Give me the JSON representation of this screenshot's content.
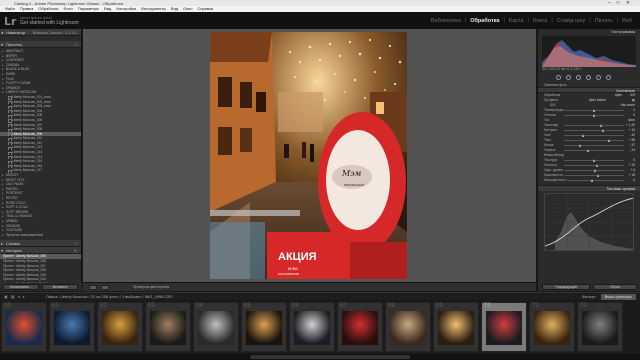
{
  "app": {
    "title": "Catalog-2 - Adobe Photoshop Lightroom Classic - Обработка",
    "menu": [
      "Файл",
      "Правка",
      "Обработка",
      "Фото",
      "Параметры",
      "Вид",
      "Настройки",
      "Инструменты",
      "Вид",
      "Окно",
      "Справка"
    ],
    "catalog_owner": "lorem ipsum dolor",
    "catalog_subtitle": "Get started with Lightroom",
    "modules": [
      "Библиотека",
      "Обработка",
      "Карта",
      "Книга",
      "Слайд-шоу",
      "Печать",
      "Веб"
    ],
    "active_module": "Обработка"
  },
  "left_panel": {
    "navigator_header": "Навигатор",
    "navigator_tools": "Вписать  Заполн.  1:1  3:1",
    "presets_header": "Пресеты",
    "presets": [
      {
        "label": "ABSTRACT",
        "type": "folder"
      },
      {
        "label": "BERRY",
        "type": "folder"
      },
      {
        "label": "CONTRAST",
        "type": "folder"
      },
      {
        "label": "CINEMA",
        "type": "folder"
      },
      {
        "label": "BLACK & BLUE",
        "type": "folder"
      },
      {
        "label": "DARK",
        "type": "folder"
      },
      {
        "label": "FILM",
        "type": "folder"
      },
      {
        "label": "FLUFFY CLEAN",
        "type": "folder"
      },
      {
        "label": "ORANGE",
        "type": "folder"
      },
      {
        "label": "LIBERTY MOSCOW",
        "type": "folder-open"
      },
      {
        "label": "Liberty Moscow_001_ecoc",
        "type": "child"
      },
      {
        "label": "Liberty Moscow_002_ecoc",
        "type": "child"
      },
      {
        "label": "Liberty Moscow_003_ecoc",
        "type": "child"
      },
      {
        "label": "Liberty Moscow_004",
        "type": "child"
      },
      {
        "label": "Liberty Moscow_005",
        "type": "child"
      },
      {
        "label": "Liberty Moscow_006",
        "type": "child"
      },
      {
        "label": "Liberty Moscow_007",
        "type": "child"
      },
      {
        "label": "Liberty Moscow_008",
        "type": "child"
      },
      {
        "label": "Liberty Moscow_009",
        "type": "child-selected"
      },
      {
        "label": "Liberty Moscow_010",
        "type": "child"
      },
      {
        "label": "Liberty Moscow_011",
        "type": "child"
      },
      {
        "label": "Liberty Moscow_012",
        "type": "child"
      },
      {
        "label": "Liberty Moscow_013",
        "type": "child"
      },
      {
        "label": "Liberty Moscow_014",
        "type": "child"
      },
      {
        "label": "Liberty Moscow_015",
        "type": "child"
      },
      {
        "label": "Liberty Moscow_016",
        "type": "child"
      },
      {
        "label": "Liberty Moscow_017",
        "type": "child"
      },
      {
        "label": "MOODY",
        "type": "folder"
      },
      {
        "label": "NIGHT CITY",
        "type": "folder"
      },
      {
        "label": "OLD FILMS",
        "type": "folder"
      },
      {
        "label": "PASTEL",
        "type": "folder"
      },
      {
        "label": "PORTRAIT",
        "type": "folder"
      },
      {
        "label": "RETRO",
        "type": "folder"
      },
      {
        "label": "ROSE GOLD",
        "type": "folder"
      },
      {
        "label": "SOFT & COLD",
        "type": "folder"
      },
      {
        "label": "SOFT BROWN",
        "type": "folder"
      },
      {
        "label": "TEAL & ORANGE",
        "type": "folder"
      },
      {
        "label": "URBAN",
        "type": "folder"
      },
      {
        "label": "VINTAGE",
        "type": "folder"
      },
      {
        "label": "YOUTUBE",
        "type": "folder"
      },
      {
        "label": "Пресеты пользователей",
        "type": "folder"
      }
    ],
    "snapshots_header": "Снимки",
    "history_header": "История",
    "history": [
      "Пресет: Liberty Moscow_009",
      "Пресет: Liberty Moscow_008",
      "Пресет: Liberty Moscow_007",
      "Пресет: Liberty Moscow_006",
      "Пресет: Liberty Moscow_005",
      "Пресет: Liberty Moscow_004",
      "Импорт (21.01.2021 18:05:27)"
    ],
    "copy_button": "Копировать...",
    "paste_button": "Вставить"
  },
  "toolbar": {
    "soft_proof": "Проверка цветопробы"
  },
  "right_panel": {
    "histogram_header": "Гистограмма",
    "histogram_info": "ISO 1600   35 мм   f/1,4   1/80 с",
    "original_photo": "Оригинал фото",
    "basic_header": "Основные",
    "treatment_label": "Обработка:",
    "treatment_color": "Цвет",
    "treatment_bw": "Ч/б",
    "profile_label": "Профиль:",
    "profile_value": "Цвет Adobe",
    "wb_label": "Б/Б:",
    "wb_value": "Как снято",
    "sliders": [
      {
        "label": "Температура",
        "value": "0",
        "pos": 0.5
      },
      {
        "label": "Оттенок",
        "value": "0",
        "pos": 0.5
      },
      {
        "label": "Тон",
        "value": "Авто",
        "pos": -1
      },
      {
        "label": "Экспонир.",
        "value": "+ 1,20",
        "pos": 0.62
      },
      {
        "label": "Контраст",
        "value": "+ 43",
        "pos": 0.66
      },
      {
        "label": "Свет",
        "value": "- 40",
        "pos": 0.32
      },
      {
        "label": "Тени",
        "value": "+ 58",
        "pos": 0.75
      },
      {
        "label": "Белые",
        "value": "- 57",
        "pos": 0.28
      },
      {
        "label": "Черные",
        "value": "- 24",
        "pos": 0.4
      },
      {
        "label": "Внешний вид",
        "value": "",
        "pos": -1
      },
      {
        "label": "Текстура",
        "value": "0",
        "pos": 0.5
      },
      {
        "label": "Четкость",
        "value": "+ 15",
        "pos": 0.56
      },
      {
        "label": "Удал. дымки",
        "value": "+ 6",
        "pos": 0.53
      },
      {
        "label": "Красочность",
        "value": "+ 18",
        "pos": 0.58
      },
      {
        "label": "Насыщенность",
        "value": "- 6",
        "pos": 0.47
      }
    ],
    "tone_curve_header": "Тоновая кривая",
    "prev_button": "Предыдущий",
    "reset_button": "Сброс"
  },
  "filmstrip": {
    "path_text": "Папка: Liberty Moscow  /  21 из 258 фото  /  1 выбрано  /  IMG_0996.CR2",
    "filter_label": "Фильтр:",
    "filter_value": "Выкл фильтры",
    "numbers": [
      "60",
      "61",
      "62",
      "63",
      "64",
      "65",
      "66",
      "67",
      "68",
      "69",
      "70",
      "71",
      "72"
    ],
    "selected_index": 10
  },
  "colors": {
    "accent_selected": "#5b5b5b",
    "panel_bg": "#2b2b2b",
    "center_bg": "#535353"
  }
}
